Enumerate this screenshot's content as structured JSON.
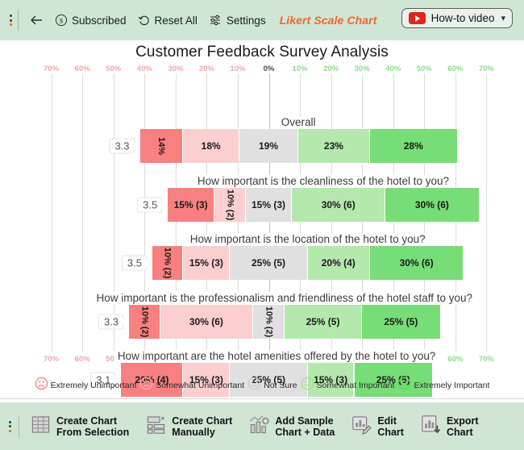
{
  "topbar": {
    "back_label": "back",
    "subscribed_label": "Subscribed",
    "reset_label": "Reset All",
    "settings_label": "Settings",
    "chart_type_label": "Likert Scale Chart",
    "howto_label": "How-to video"
  },
  "legend": [
    {
      "label": "Extremely Unimportant",
      "color": "#F98080",
      "face": "frown"
    },
    {
      "label": "Somewhat Unimportant",
      "color": "#FBB4B4",
      "face": "slight-frown"
    },
    {
      "label": "Not Sure",
      "color": "#C9C9C9",
      "face": "neutral"
    },
    {
      "label": "Somewhat Important",
      "color": "#9FE08F",
      "face": "slight-smile"
    },
    {
      "label": "Extremely Important",
      "color": "#5FD45F",
      "face": "smile"
    }
  ],
  "bottombar": [
    {
      "line1": "Create Chart",
      "line2": "From Selection",
      "icon": "table-grid-icon"
    },
    {
      "line1": "Create Chart",
      "line2": "Manually",
      "icon": "layout-blocks-icon"
    },
    {
      "line1": "Add Sample",
      "line2": "Chart + Data",
      "icon": "chart-plus-icon"
    },
    {
      "line1": "Edit",
      "line2": "Chart",
      "icon": "chart-pencil-icon"
    },
    {
      "line1": "Export",
      "line2": "Chart",
      "icon": "chart-download-icon"
    }
  ],
  "chart_data": {
    "type": "bar",
    "title": "Customer Feedback Survey Analysis",
    "subtype": "diverging-stacked-likert",
    "xlabel": "",
    "ylabel": "",
    "xlim": [
      -70,
      70
    ],
    "xticks": [
      "70%",
      "60%",
      "50%",
      "40%",
      "30%",
      "20%",
      "10%",
      "0%",
      "10%",
      "20%",
      "30%",
      "40%",
      "50%",
      "60%",
      "70%"
    ],
    "grid": true,
    "legend_position": "bottom",
    "colors": {
      "extremely_unimportant": "#F98080",
      "somewhat_unimportant": "#FBCFCF",
      "not_sure": "#E0E0E0",
      "somewhat_important": "#B4E8AD",
      "extremely_important": "#77DD77",
      "negative_tick": "#F4A6A6",
      "positive_tick": "#8FD98F",
      "zero_tick": "#4A4A4A",
      "accent": "#F0662B",
      "toolbar_bg": "#CFE6D4"
    },
    "categories": [
      "Extremely Unimportant",
      "Somewhat Unimportant",
      "Not Sure",
      "Somewhat Important",
      "Extremely Important"
    ],
    "rows": [
      {
        "question": "Overall",
        "score": "3.3",
        "values": [
          14,
          18,
          19,
          23,
          28
        ],
        "labels": [
          "14%",
          "18%",
          "19%",
          "23%",
          "28%"
        ],
        "rotated": [
          true,
          false,
          false,
          false,
          false
        ]
      },
      {
        "question": "How important is the cleanliness of the hotel to you?",
        "score": "3.5",
        "values": [
          15,
          10,
          15,
          30,
          30
        ],
        "labels": [
          "15% (3)",
          "10% (2)",
          "15% (3)",
          "30% (6)",
          "30% (6)"
        ],
        "rotated": [
          false,
          true,
          false,
          false,
          false
        ]
      },
      {
        "question": "How important is the location of the hotel to you?",
        "score": "3.5",
        "values": [
          10,
          15,
          25,
          20,
          30
        ],
        "labels": [
          "10% (2)",
          "15% (3)",
          "25% (5)",
          "20% (4)",
          "30% (6)"
        ],
        "rotated": [
          true,
          false,
          false,
          false,
          false
        ]
      },
      {
        "question": "How important is the professionalism and friendliness of the hotel staff to you?",
        "score": "3.3",
        "values": [
          10,
          30,
          10,
          25,
          25
        ],
        "labels": [
          "10% (2)",
          "30% (6)",
          "10% (2)",
          "25% (5)",
          "25% (5)"
        ],
        "rotated": [
          true,
          false,
          true,
          false,
          false
        ]
      },
      {
        "question": "How important are the hotel amenities offered by the hotel to you?",
        "score": "3.1",
        "values": [
          20,
          15,
          25,
          15,
          25
        ],
        "labels": [
          "20% (4)",
          "15% (3)",
          "25% (5)",
          "15% (3)",
          "25% (5)"
        ],
        "rotated": [
          false,
          false,
          false,
          false,
          false
        ]
      }
    ]
  }
}
